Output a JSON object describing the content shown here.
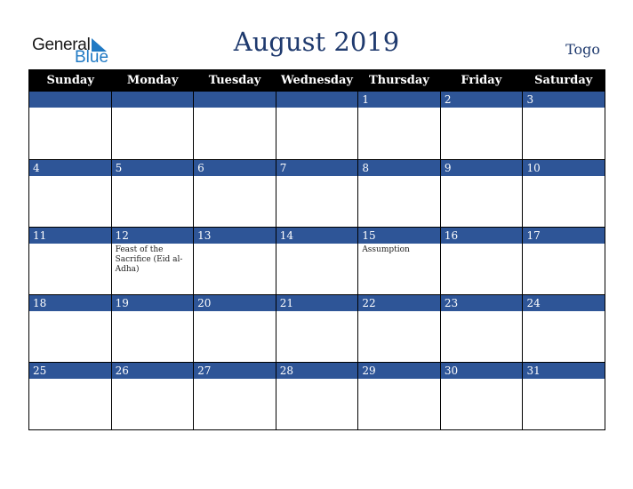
{
  "logo": {
    "general": "General",
    "blue": "Blue"
  },
  "title": "August 2019",
  "country": "Togo",
  "weekdays": [
    "Sunday",
    "Monday",
    "Tuesday",
    "Wednesday",
    "Thursday",
    "Friday",
    "Saturday"
  ],
  "weeks": [
    [
      {
        "day": "",
        "event": ""
      },
      {
        "day": "",
        "event": ""
      },
      {
        "day": "",
        "event": ""
      },
      {
        "day": "",
        "event": ""
      },
      {
        "day": "1",
        "event": ""
      },
      {
        "day": "2",
        "event": ""
      },
      {
        "day": "3",
        "event": ""
      }
    ],
    [
      {
        "day": "4",
        "event": ""
      },
      {
        "day": "5",
        "event": ""
      },
      {
        "day": "6",
        "event": ""
      },
      {
        "day": "7",
        "event": ""
      },
      {
        "day": "8",
        "event": ""
      },
      {
        "day": "9",
        "event": ""
      },
      {
        "day": "10",
        "event": ""
      }
    ],
    [
      {
        "day": "11",
        "event": ""
      },
      {
        "day": "12",
        "event": "Feast of the Sacrifice (Eid al-Adha)"
      },
      {
        "day": "13",
        "event": ""
      },
      {
        "day": "14",
        "event": ""
      },
      {
        "day": "15",
        "event": "Assumption"
      },
      {
        "day": "16",
        "event": ""
      },
      {
        "day": "17",
        "event": ""
      }
    ],
    [
      {
        "day": "18",
        "event": ""
      },
      {
        "day": "19",
        "event": ""
      },
      {
        "day": "20",
        "event": ""
      },
      {
        "day": "21",
        "event": ""
      },
      {
        "day": "22",
        "event": ""
      },
      {
        "day": "23",
        "event": ""
      },
      {
        "day": "24",
        "event": ""
      }
    ],
    [
      {
        "day": "25",
        "event": ""
      },
      {
        "day": "26",
        "event": ""
      },
      {
        "day": "27",
        "event": ""
      },
      {
        "day": "28",
        "event": ""
      },
      {
        "day": "29",
        "event": ""
      },
      {
        "day": "30",
        "event": ""
      },
      {
        "day": "31",
        "event": ""
      }
    ]
  ]
}
